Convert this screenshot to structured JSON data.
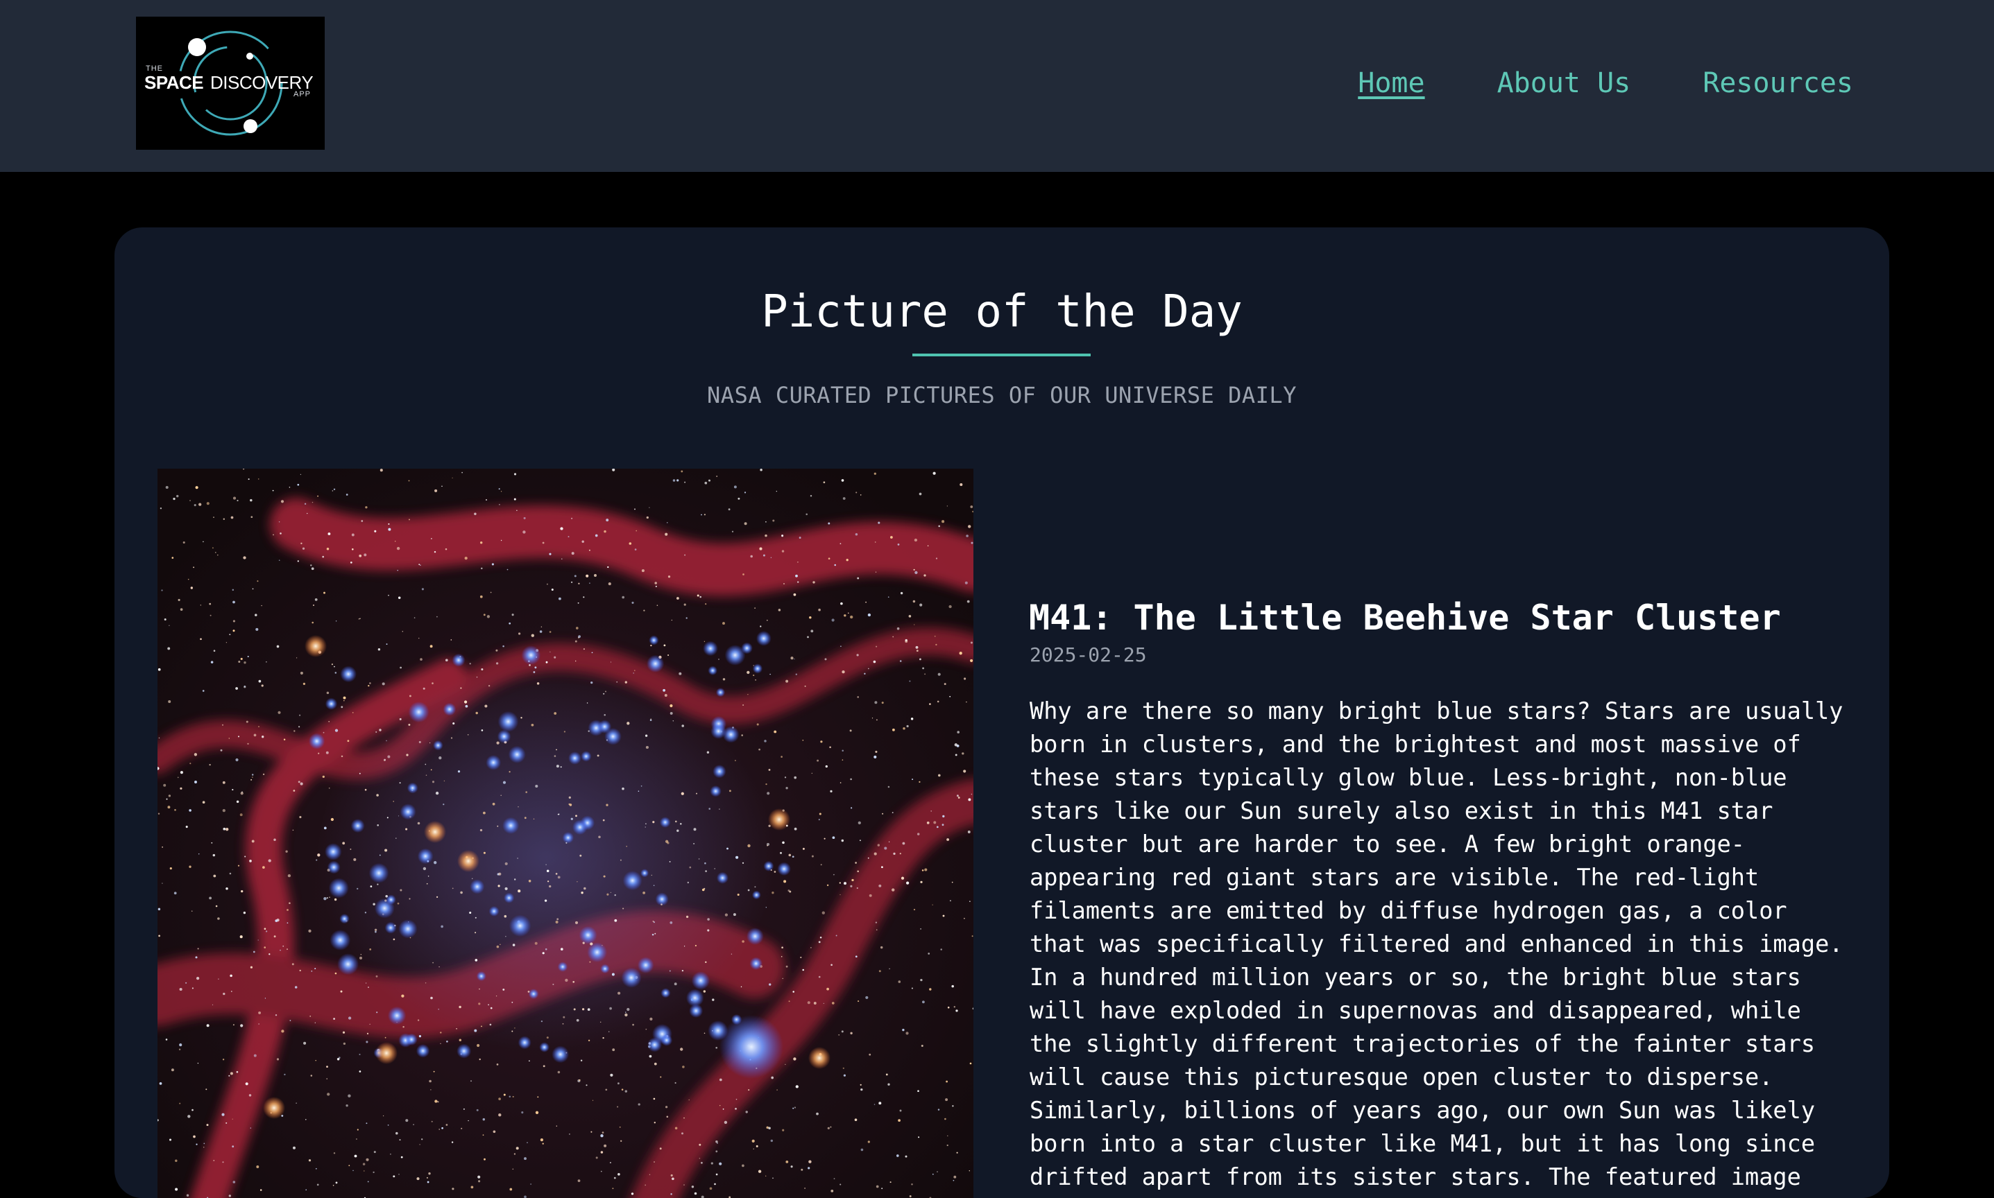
{
  "header": {
    "logo": {
      "the": "THE",
      "space": "SPACE",
      "discovery": "DISCOVERY",
      "app": "APP"
    },
    "nav": [
      {
        "label": "Home",
        "active": true
      },
      {
        "label": "About Us",
        "active": false
      },
      {
        "label": "Resources",
        "active": false
      }
    ]
  },
  "main": {
    "title": "Picture of the Day",
    "subtitle": "NASA CURATED PICTURES OF OUR UNIVERSE DAILY",
    "apod": {
      "title": "M41: The Little Beehive Star Cluster",
      "date": "2025-02-25",
      "explanation": "Why are there so many bright blue stars? Stars are usually born in clusters, and the brightest and most massive of these stars typically glow blue. Less-bright, non-blue stars like our Sun surely also exist in this M41 star cluster but are harder to see. A few bright orange-appearing red giant stars are visible. The red-light filaments are emitted by diffuse hydrogen gas, a color that was specifically filtered and enhanced in this image. In a hundred million years or so, the bright blue stars will have exploded in supernovas and disappeared, while the slightly different trajectories of the fainter stars will cause this picturesque open cluster to disperse. Similarly, billions of years ago, our own Sun was likely born into a star cluster like M41, but it has long since drifted apart from its sister stars. The featured image"
    }
  },
  "colors": {
    "header_bg": "#222a38",
    "page_bg": "#000000",
    "card_bg": "#111827",
    "accent": "#5ec8b6",
    "muted_text": "#9ca3af"
  }
}
